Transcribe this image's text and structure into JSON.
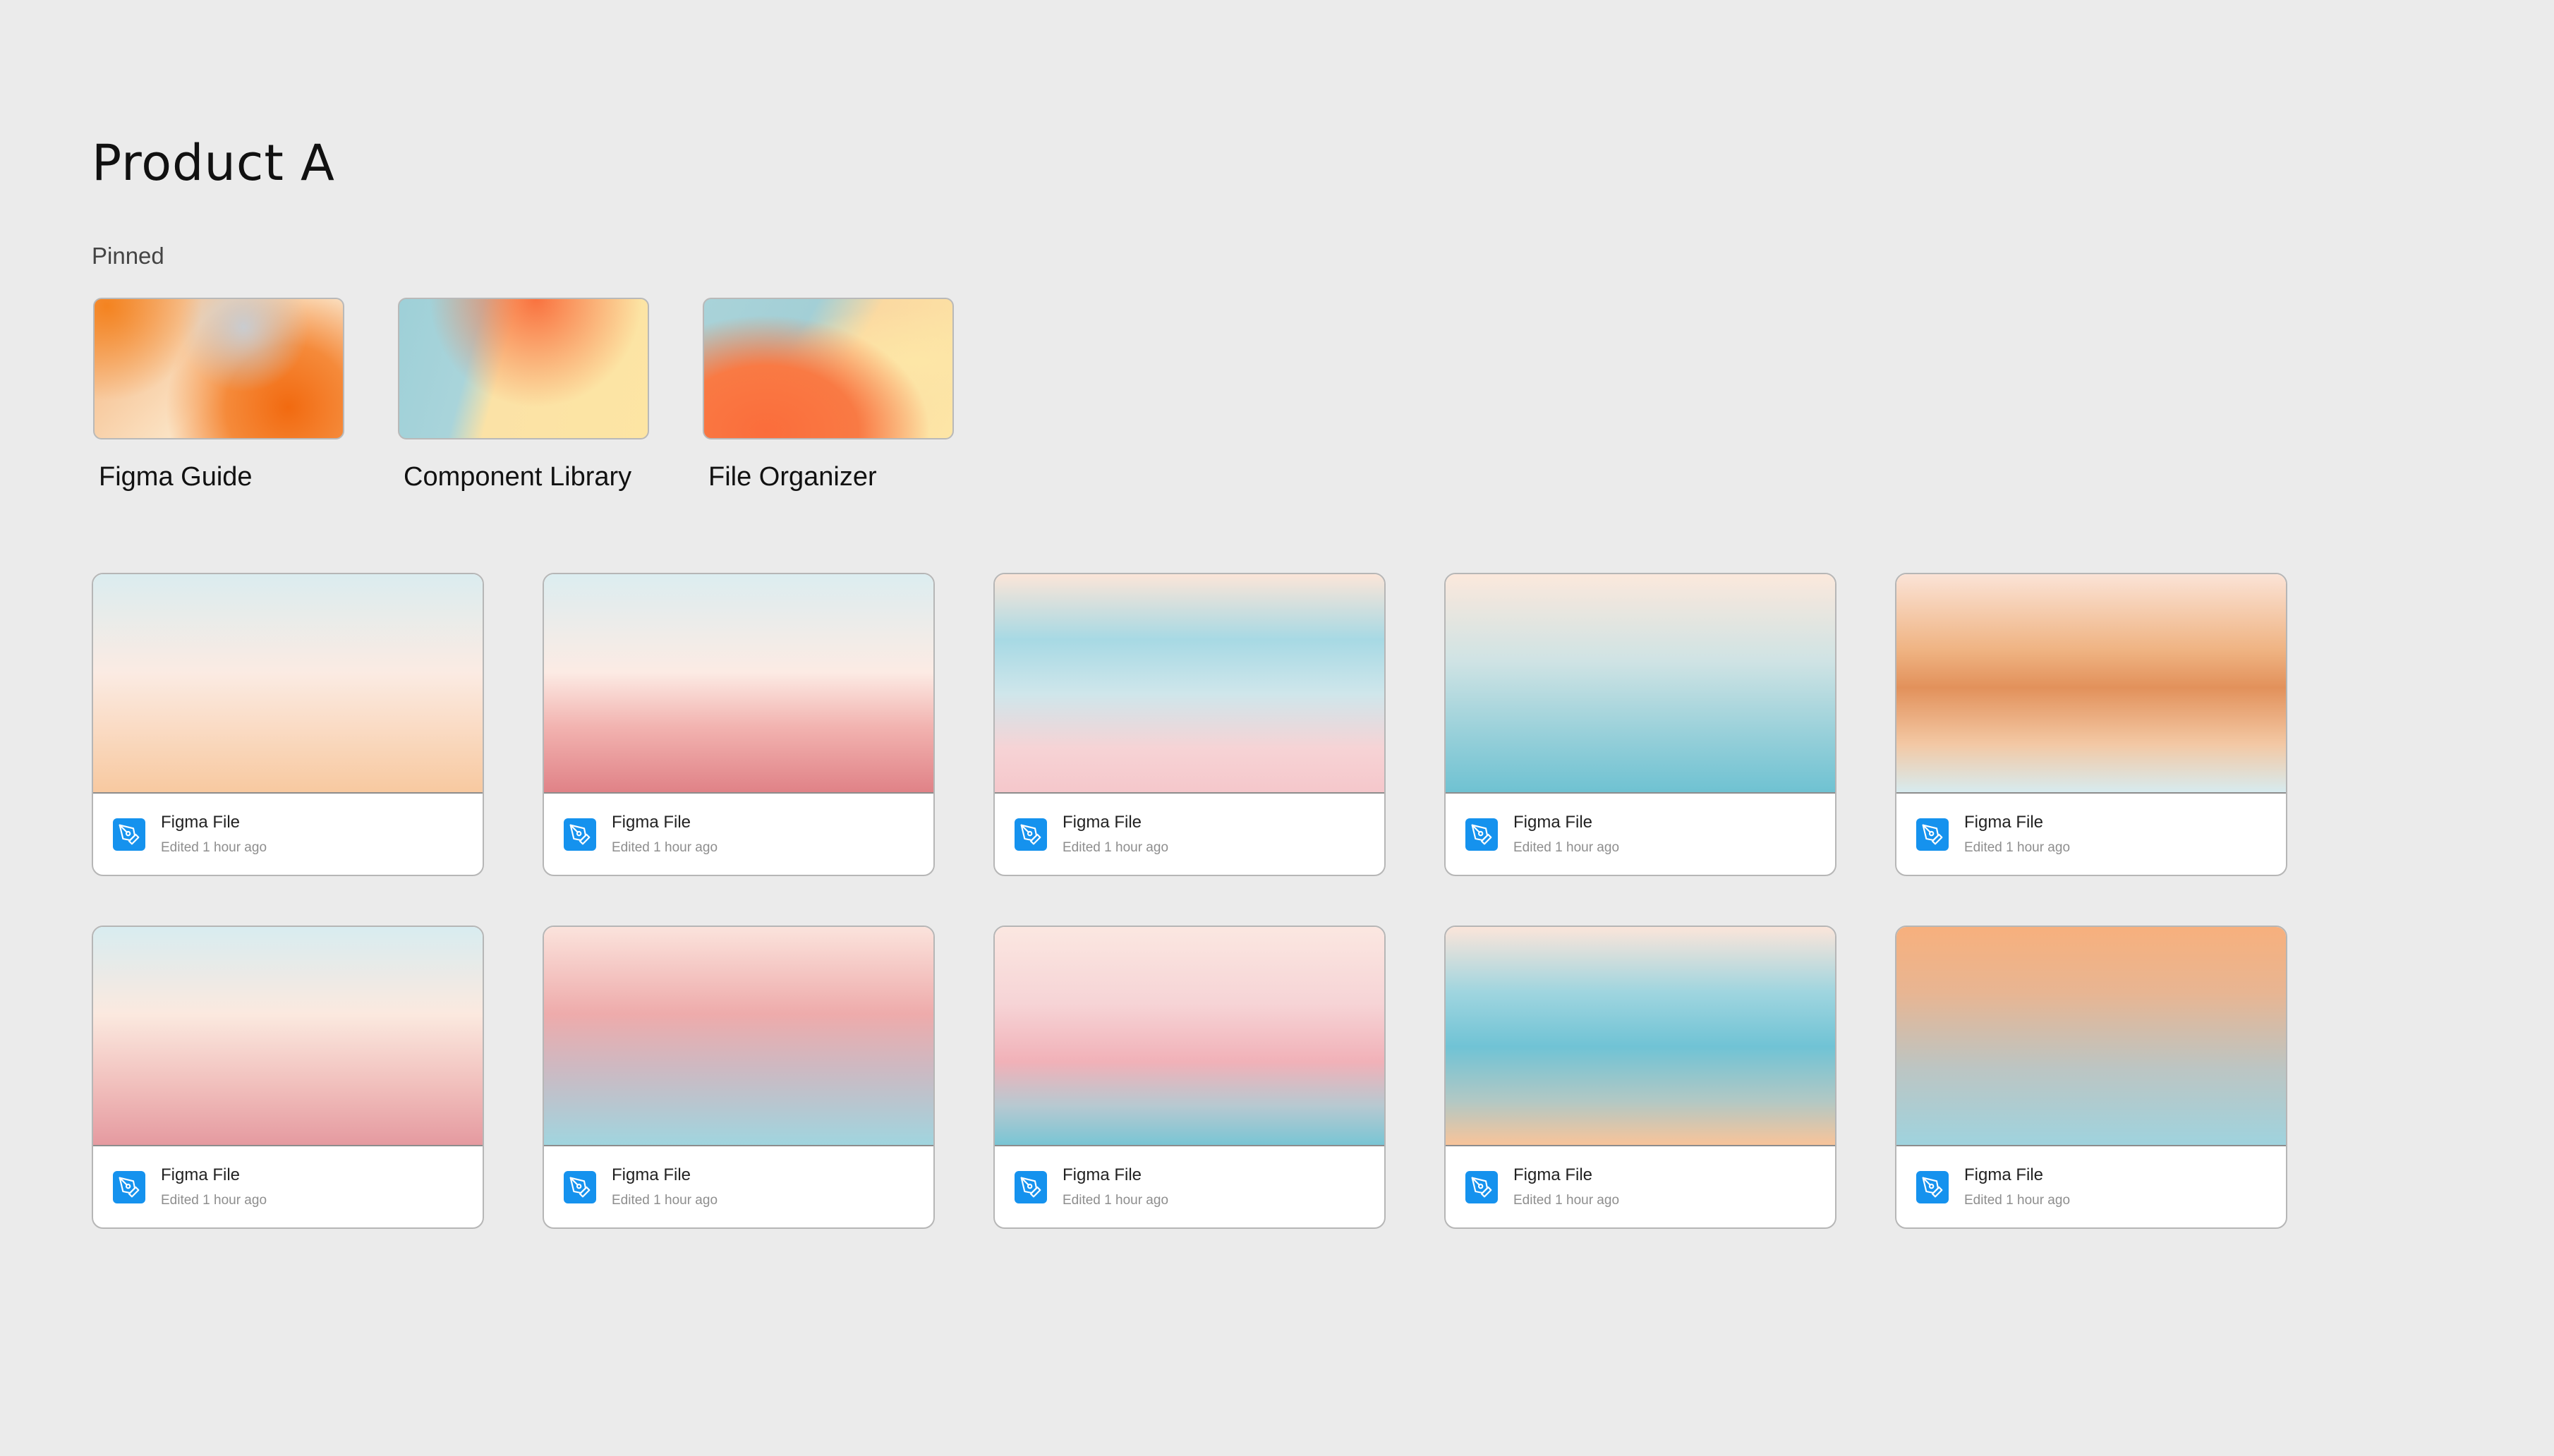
{
  "page": {
    "title": "Product A",
    "pinned_label": "Pinned"
  },
  "pinned": [
    {
      "name": "Figma Guide",
      "gradient": "radial-gradient(circle at 5% 5%, #f48320 0%, rgba(244,131,32,0) 35%), radial-gradient(circle at 60% 20%, #c9ccd0 0%, rgba(201,204,208,0) 35%), radial-gradient(circle at 78% 78%, #f26a10 0%, #f58a3a 28%, rgba(245,138,58,0) 55%), linear-gradient(135deg, #f4b27c 0%, #fbe3c4 55%, #f7d4b5 100%)"
    },
    {
      "name": "Component Library",
      "gradient": "linear-gradient(160deg, rgba(250,110,60,0) 0%, rgba(250,110,60,0) 100%), radial-gradient(ellipse at 55% 0%, #f9723f 0%, rgba(249,114,63,0) 55%), linear-gradient(105deg, #9ed0d8 0%, #a9d4da 30%, #fbe2a6 42%, #fde5a3 100%)"
    },
    {
      "name": "File Organizer",
      "gradient": "radial-gradient(ellipse at 25% 95%, #fb6d3b 0%, #f97a44 35%, rgba(249,122,68,0) 62%), radial-gradient(ellipse at 85% 45%, #fde6a6 0%, rgba(253,230,166,0) 50%), linear-gradient(120deg, #a9d3d9 0%, #a3cfd6 35%, #fbd9a1 55%, #fde6a6 100%)"
    }
  ],
  "files": [
    {
      "title": "Figma File",
      "subtitle": "Edited 1 hour ago",
      "gradient": "linear-gradient(180deg, #dbecef 0%, #fbebe3 45%, #f8c9a0 100%)"
    },
    {
      "title": "Figma File",
      "subtitle": "Edited 1 hour ago",
      "gradient": "linear-gradient(180deg, #dcedf0 0%, #fcebe4 45%, #f2b3b0 70%, #e08287 100%)"
    },
    {
      "title": "Figma File",
      "subtitle": "Edited 1 hour ago",
      "gradient": "linear-gradient(180deg, #fbe5d8 0%, #a7d9e4 30%, #cfe6eb 55%, #f6d3d5 80%, #f5c7cb 100%)"
    },
    {
      "title": "Figma File",
      "subtitle": "Edited 1 hour ago",
      "gradient": "linear-gradient(180deg, #fbe8dc 0%, #cfe3e4 40%, #95cfd9 75%, #6fc2d2 100%)"
    },
    {
      "title": "Figma File",
      "subtitle": "Edited 1 hour ago",
      "gradient": "linear-gradient(180deg, #fbe3d6 0%, #efb382 35%, #e2915b 52%, #f3c8a4 78%, #d7ebef 100%)"
    },
    {
      "title": "Figma File",
      "subtitle": "Edited 1 hour ago",
      "gradient": "linear-gradient(180deg, #d8ecf0 0%, #fbe9df 40%, #f1c0bd 72%, #e59aa0 100%)"
    },
    {
      "title": "Figma File",
      "subtitle": "Edited 1 hour ago",
      "gradient": "linear-gradient(180deg, #fbe3dc 0%, #eeabab 40%, #cdb9c2 65%, #a0d5df 100%)"
    },
    {
      "title": "Figma File",
      "subtitle": "Edited 1 hour ago",
      "gradient": "linear-gradient(180deg, #fbe7e1 0%, #f6d4d6 35%, #f1b1b8 62%, #b7c9d1 82%, #79c5d4 100%)"
    },
    {
      "title": "Figma File",
      "subtitle": "Edited 1 hour ago",
      "gradient": "linear-gradient(180deg, #fbe5da 0%, #9fd5df 30%, #70c3d5 55%, #b2c8c4 80%, #f8c49a 100%)"
    },
    {
      "title": "Figma File",
      "subtitle": "Edited 1 hour ago",
      "gradient": "linear-gradient(180deg, #f7b07d 0%, #e8b592 30%, #bcc5c3 65%, #9fd3de 100%)"
    }
  ],
  "icon": {
    "name": "pen-tool-icon",
    "color": "#1592ee"
  }
}
